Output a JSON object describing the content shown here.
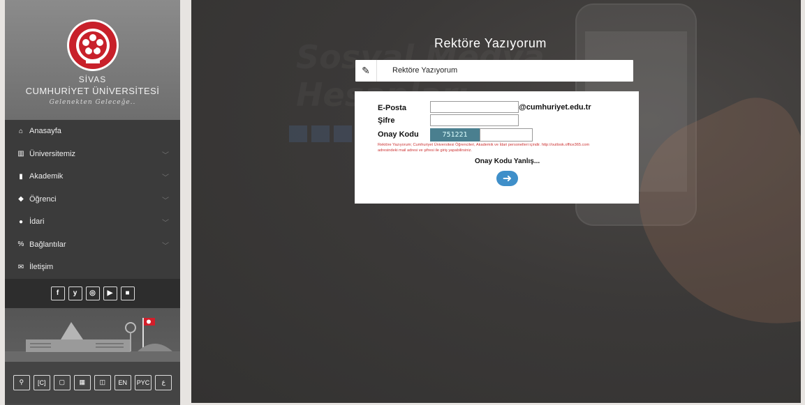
{
  "brand": {
    "city": "SİVAS",
    "university": "CUMHURİYET ÜNİVERSİTESİ",
    "slogan": "Gelenekten Geleceğe..",
    "logo_text_top": "SİVAS CUMHURİYET ÜNİVERSİTESİ",
    "logo_year": "1974"
  },
  "menu": [
    {
      "label": "Anasayfa",
      "icon": "home-icon",
      "glyph": "⌂",
      "has_submenu": false
    },
    {
      "label": "Üniversitemiz",
      "icon": "university-icon",
      "glyph": "▥",
      "has_submenu": true
    },
    {
      "label": "Akademik",
      "icon": "bookmark-icon",
      "glyph": "▮",
      "has_submenu": true
    },
    {
      "label": "Öğrenci",
      "icon": "graduation-cap-icon",
      "glyph": "◆",
      "has_submenu": true
    },
    {
      "label": "İdari",
      "icon": "user-icon",
      "glyph": "●",
      "has_submenu": true
    },
    {
      "label": "Bağlantılar",
      "icon": "link-icon",
      "glyph": "%",
      "has_submenu": true
    },
    {
      "label": "İletişim",
      "icon": "envelope-icon",
      "glyph": "✉",
      "has_submenu": false
    }
  ],
  "social": [
    {
      "name": "facebook-icon",
      "glyph": "f"
    },
    {
      "name": "twitter-icon",
      "glyph": "y"
    },
    {
      "name": "instagram-icon",
      "glyph": "◎"
    },
    {
      "name": "youtube-icon",
      "glyph": "▶"
    },
    {
      "name": "video-camera-icon",
      "glyph": "■"
    }
  ],
  "tools": [
    {
      "name": "search-icon",
      "glyph": "⚲"
    },
    {
      "name": "accessibility-icon",
      "glyph": "[C]"
    },
    {
      "name": "tv-icon",
      "glyph": "▢"
    },
    {
      "name": "radio-icon",
      "glyph": "▦"
    },
    {
      "name": "map-icon",
      "glyph": "◫"
    },
    {
      "name": "lang-en-button",
      "glyph": "EN"
    },
    {
      "name": "lang-ru-button",
      "glyph": "PYC"
    },
    {
      "name": "lang-ar-button",
      "glyph": "ع"
    }
  ],
  "page": {
    "title": "Rektöre Yazıyorum",
    "bar_label": "Rektöre Yazıyorum"
  },
  "form": {
    "email_label": "E-Posta",
    "email_value": "",
    "email_domain": "@cumhuriyet.edu.tr",
    "password_label": "Şifre",
    "password_value": "",
    "captcha_label": "Onay Kodu",
    "captcha_code": "751221",
    "captcha_value": "",
    "note": "Rektöre Yazıyorum; Cumhuriyet Üniversitesi Öğrencileri, Akademik ve İdari personelleri içindir. http://outlook.office365.com adresindeki mail adresi ve şifresi ile giriş yapabilirsiniz.",
    "error": "Onay Kodu Yanlış..."
  },
  "colors": {
    "sidebar": "#4a4a4a",
    "accent_button": "#3f8fc9",
    "captcha_bg": "#4a7f8f",
    "note_text": "#cc3333"
  }
}
